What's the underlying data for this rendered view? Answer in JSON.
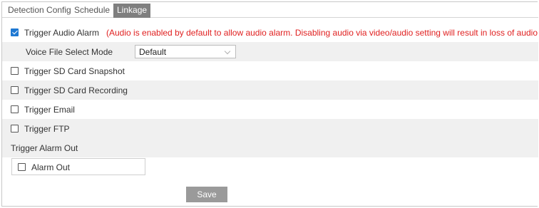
{
  "tabs": [
    {
      "label": "Detection Config",
      "active": false
    },
    {
      "label": "Schedule",
      "active": false
    },
    {
      "label": "Linkage",
      "active": true
    }
  ],
  "trigger_audio": {
    "label": "Trigger Audio Alarm",
    "checked": true,
    "note": "(Audio is enabled by default to allow audio alarm. Disabling audio via video/audio setting will result in loss of audio alarm."
  },
  "voice_file": {
    "label": "Voice File Select Mode",
    "selected": "Default"
  },
  "sd_snapshot": {
    "label": "Trigger SD Card Snapshot",
    "checked": false
  },
  "sd_recording": {
    "label": "Trigger SD Card Recording",
    "checked": false
  },
  "email": {
    "label": "Trigger Email",
    "checked": false
  },
  "ftp": {
    "label": "Trigger FTP",
    "checked": false
  },
  "alarm_out_section": {
    "label": "Trigger Alarm Out"
  },
  "alarm_out": {
    "label": "Alarm Out",
    "checked": false
  },
  "save_label": "Save",
  "colors": {
    "accent": "#1e78d2",
    "warning_text": "#e02020",
    "active_tab": "#7f7f7f",
    "save_button": "#9a9a9a",
    "shaded_row": "#f0f0f0"
  }
}
